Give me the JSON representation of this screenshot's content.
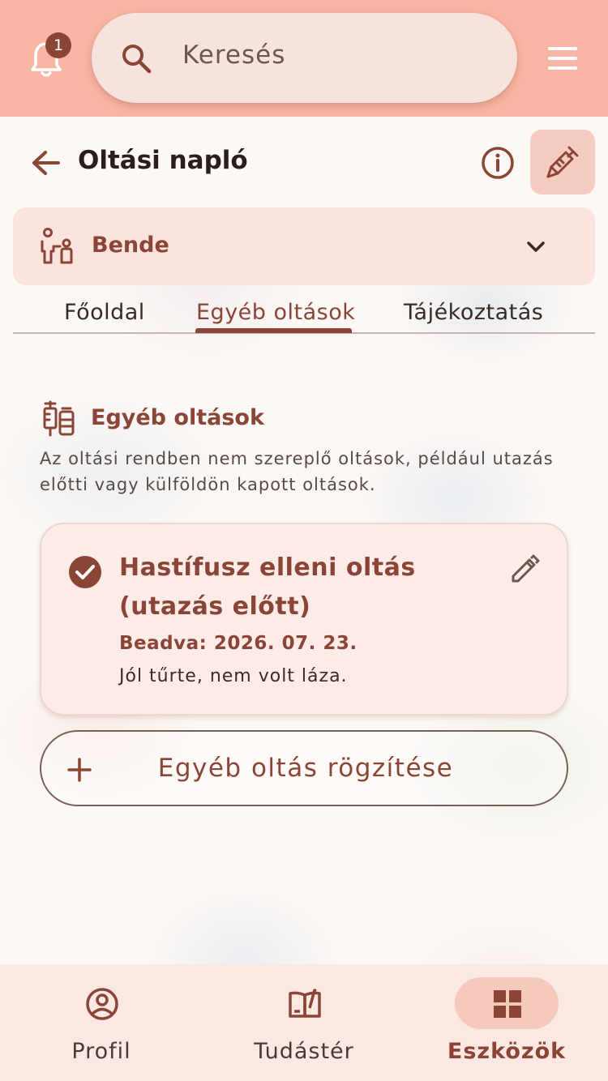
{
  "topbar": {
    "notification_count": "1",
    "search_placeholder": "Keresés"
  },
  "header": {
    "title": "Oltási napló"
  },
  "child": {
    "name": "Bende"
  },
  "tabs": [
    {
      "label": "Főoldal",
      "active": false
    },
    {
      "label": "Egyéb oltások",
      "active": true
    },
    {
      "label": "Tájékoztatás",
      "active": false
    }
  ],
  "section": {
    "title": "Egyéb oltások",
    "description": "Az oltási rendben nem szereplő oltások, például utazás előtti vagy külföldön kapott oltások."
  },
  "vaccination": {
    "name": "Hastífusz elleni oltás (utazás előtt)",
    "date": "Beadva: 2026. 07. 23.",
    "note": "Jól tűrte, nem volt láza."
  },
  "add_button": {
    "label": "Egyéb oltás rögzítése"
  },
  "bottom_nav": [
    {
      "label": "Profil",
      "icon": "profile-icon",
      "active": false
    },
    {
      "label": "Tudástér",
      "icon": "book-icon",
      "active": false
    },
    {
      "label": "Eszközök",
      "icon": "grid-icon",
      "active": true
    }
  ],
  "colors": {
    "accent": "#8b4537",
    "topbar": "#f9b5a3",
    "card": "#fcebe7"
  }
}
